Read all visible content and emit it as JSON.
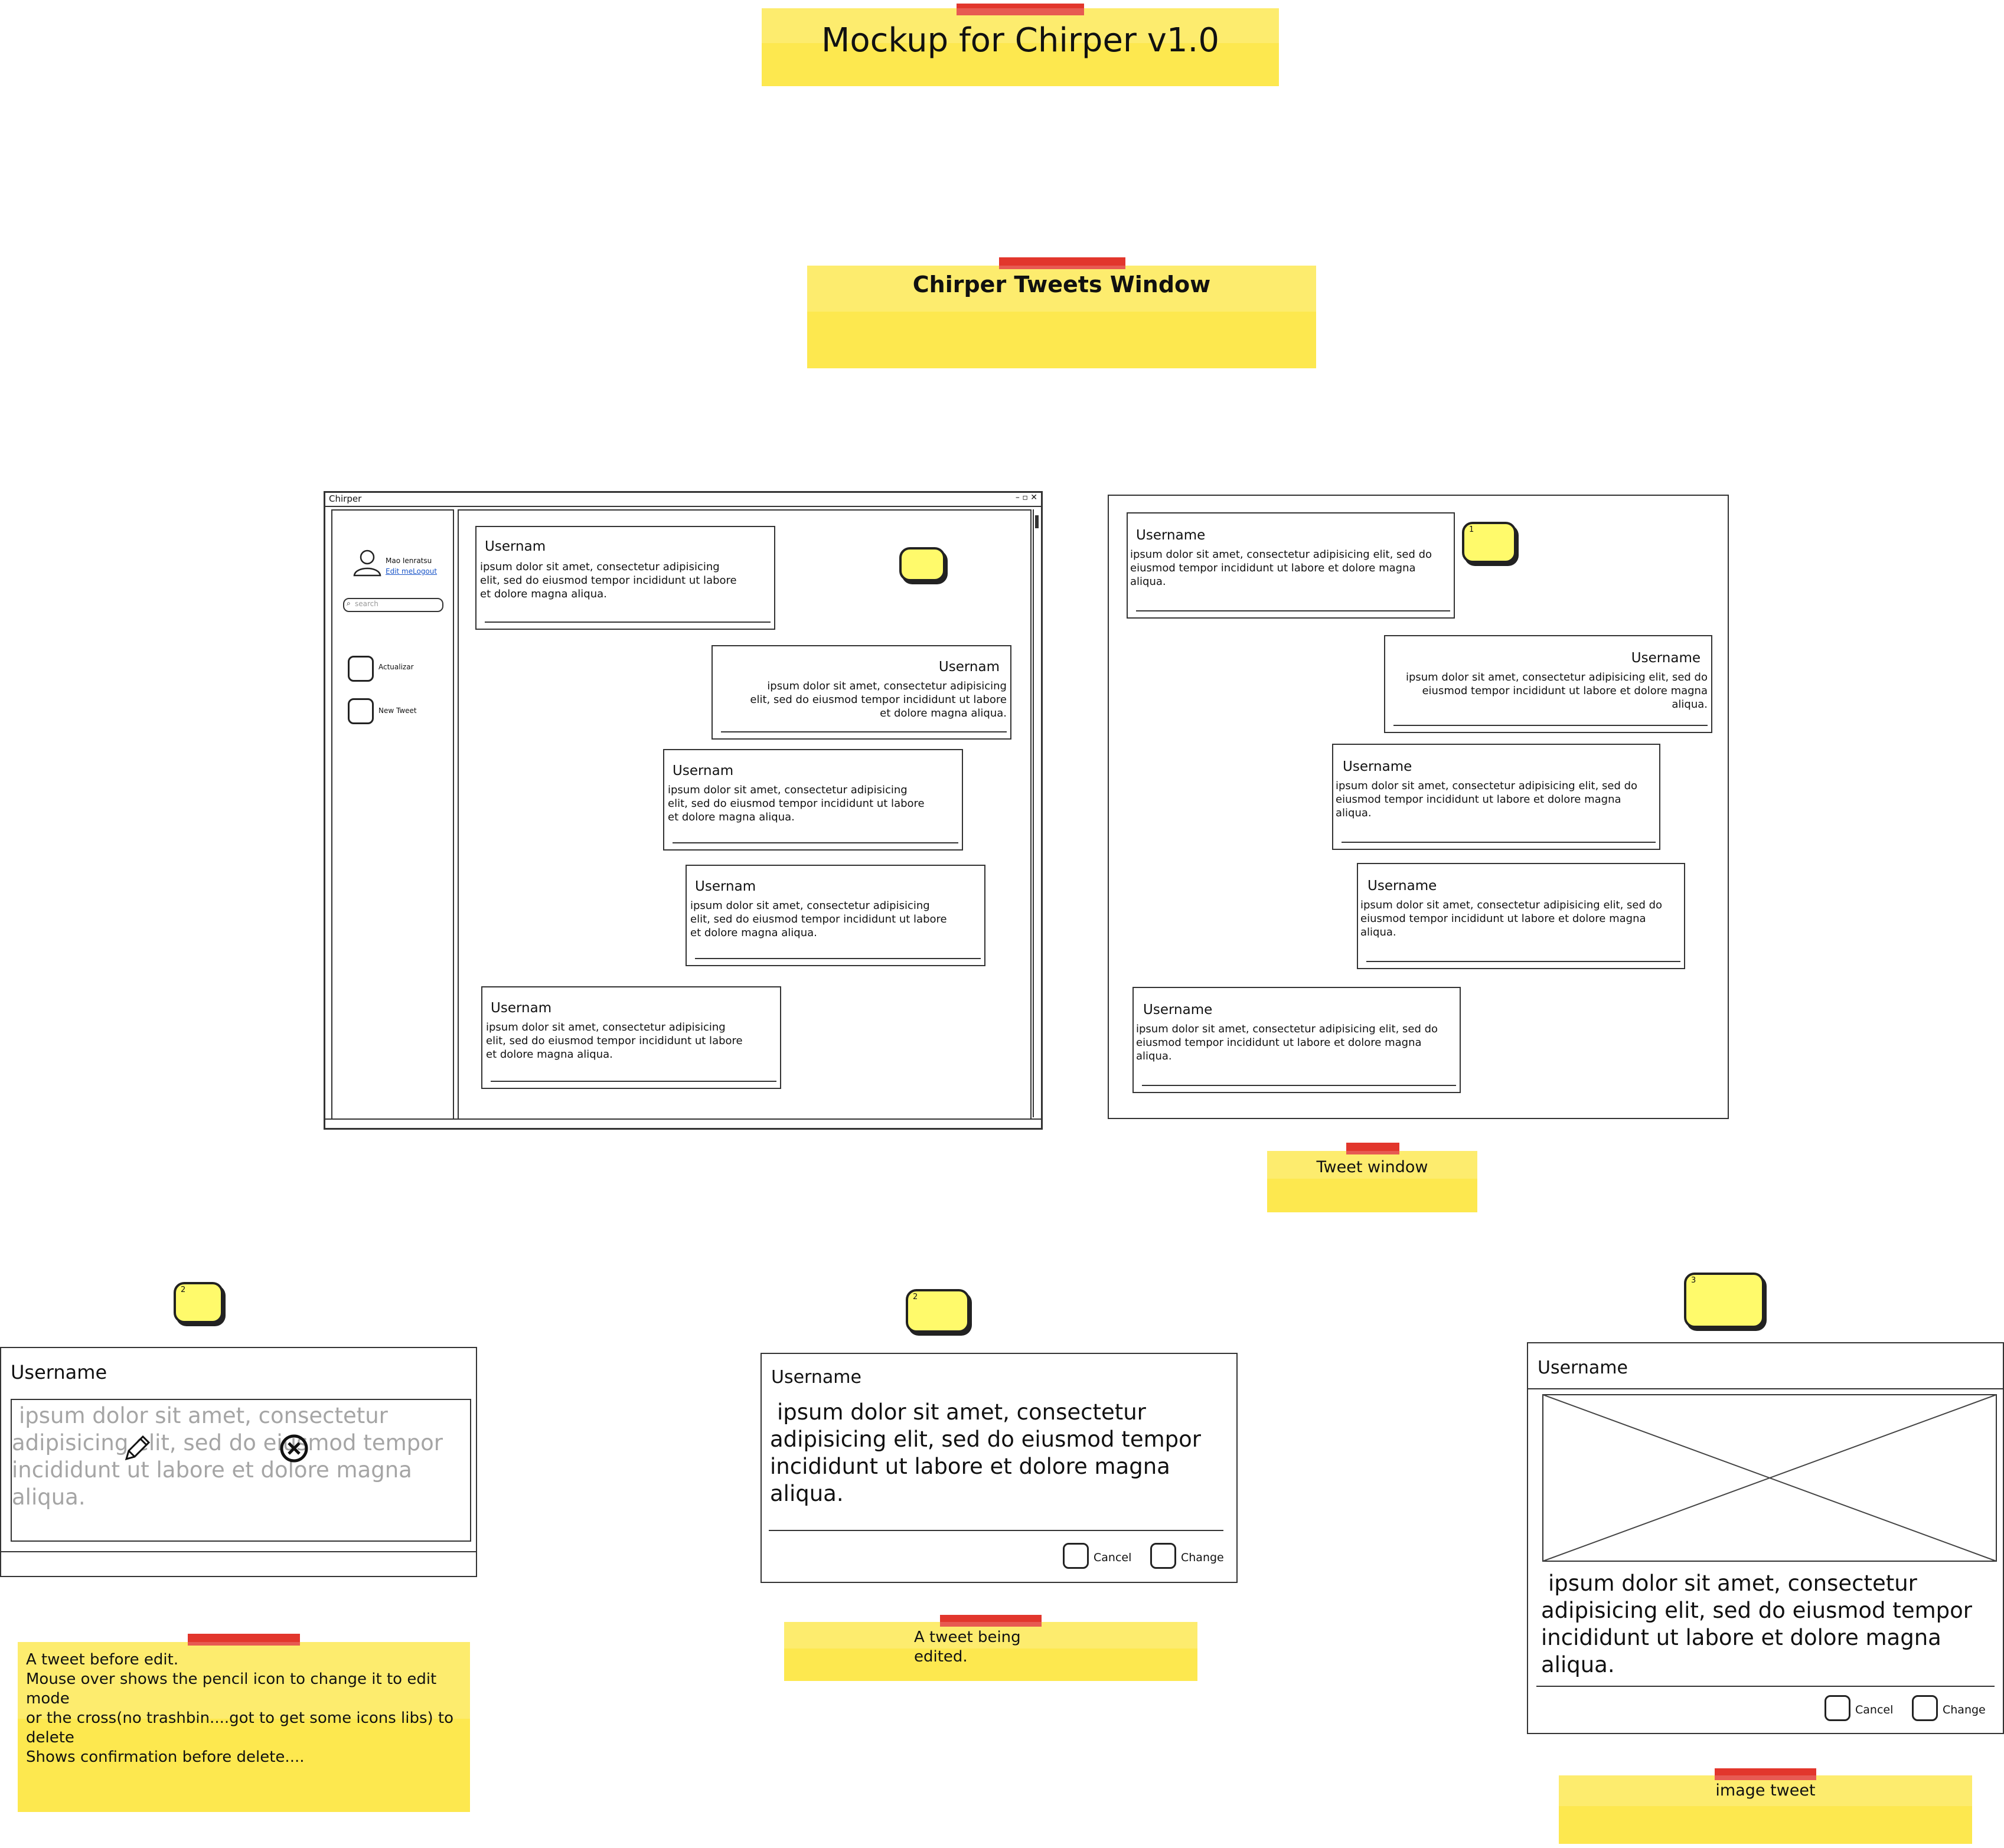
{
  "header": {
    "title": "Mockup for Chirper v1.0",
    "section_title": "Chirper Tweets Window"
  },
  "app_window": {
    "title": "Chirper",
    "controls": "– ▫ ✕",
    "sidebar": {
      "user_name": "Mao Ienratsu",
      "edit_me": "Edit me",
      "logout": "Logout",
      "search_placeholder": "search",
      "actualizar_label": "Actualizar",
      "new_tweet_label": "New Tweet"
    },
    "tweets": [
      {
        "username": "Usernam",
        "body": [
          "ipsum dolor sit amet, consectetur adipisicing",
          "elit, sed do eiusmod tempor incididunt ut labore",
          "et dolore magna aliqua."
        ]
      },
      {
        "username": "Usernam",
        "body": [
          "ipsum dolor sit amet, consectetur adipisicing",
          "elit, sed do eiusmod tempor incididunt ut labore",
          "et dolore magna aliqua."
        ]
      },
      {
        "username": "Usernam",
        "body": [
          "ipsum dolor sit amet, consectetur adipisicing",
          "elit, sed do eiusmod tempor incididunt ut labore",
          "et dolore magna aliqua."
        ]
      },
      {
        "username": "Usernam",
        "body": [
          "ipsum dolor sit amet, consectetur adipisicing",
          "elit, sed do eiusmod tempor incididunt ut labore",
          "et dolore magna aliqua."
        ]
      },
      {
        "username": "Usernam",
        "body": [
          "ipsum dolor sit amet, consectetur adipisicing",
          "elit, sed do eiusmod tempor incididunt ut labore",
          "et dolore magna aliqua."
        ]
      }
    ]
  },
  "tweet_window": {
    "bubble_number": "1",
    "tweets": [
      {
        "username": "Username",
        "body": [
          "ipsum dolor sit amet, consectetur adipisicing elit, sed do",
          "eiusmod tempor incididunt ut labore et dolore magna",
          "aliqua."
        ]
      },
      {
        "username": "Username",
        "body": [
          "ipsum dolor sit amet, consectetur adipisicing elit, sed do",
          "eiusmod tempor incididunt ut labore et dolore magna",
          "aliqua."
        ]
      },
      {
        "username": "Username",
        "body": [
          "ipsum dolor sit amet, consectetur adipisicing elit, sed do",
          "eiusmod tempor incididunt ut labore et dolore magna",
          "aliqua."
        ]
      },
      {
        "username": "Username",
        "body": [
          "ipsum dolor sit amet, consectetur adipisicing elit, sed do",
          "eiusmod tempor incididunt ut labore et dolore magna",
          "aliqua."
        ]
      },
      {
        "username": "Username",
        "body": [
          "ipsum dolor sit amet, consectetur adipisicing elit, sed do",
          "eiusmod tempor incididunt ut labore et dolore magna",
          "aliqua."
        ]
      }
    ],
    "caption": "Tweet window"
  },
  "before_edit": {
    "bubble_number": "2",
    "username": "Username",
    "body": [
      "ipsum dolor sit amet, consectetur",
      "adipisicing elit, sed do eiusmod tempor",
      "incididunt ut labore et dolore magna aliqua."
    ],
    "caption": [
      "A tweet before edit.",
      "Mouse over shows the pencil icon to change it to edit mode",
      "or the cross(no trashbin....got to get some icons libs) to",
      "delete",
      "Shows confirmation before delete...."
    ]
  },
  "being_edited": {
    "bubble_number": "2",
    "username": "Username",
    "body": [
      "ipsum dolor sit amet, consectetur",
      "adipisicing elit, sed do eiusmod tempor",
      "incididunt ut labore et dolore magna aliqua."
    ],
    "cancel_label": "Cancel",
    "change_label": "Change",
    "caption": [
      "A tweet being",
      "edited."
    ]
  },
  "image_tweet": {
    "bubble_number": "3",
    "username": "Username",
    "body": [
      "ipsum dolor sit amet, consectetur",
      "adipisicing elit, sed do eiusmod tempor",
      "incididunt ut labore et dolore magna aliqua."
    ],
    "cancel_label": "Cancel",
    "change_label": "Change",
    "caption": "image tweet"
  }
}
